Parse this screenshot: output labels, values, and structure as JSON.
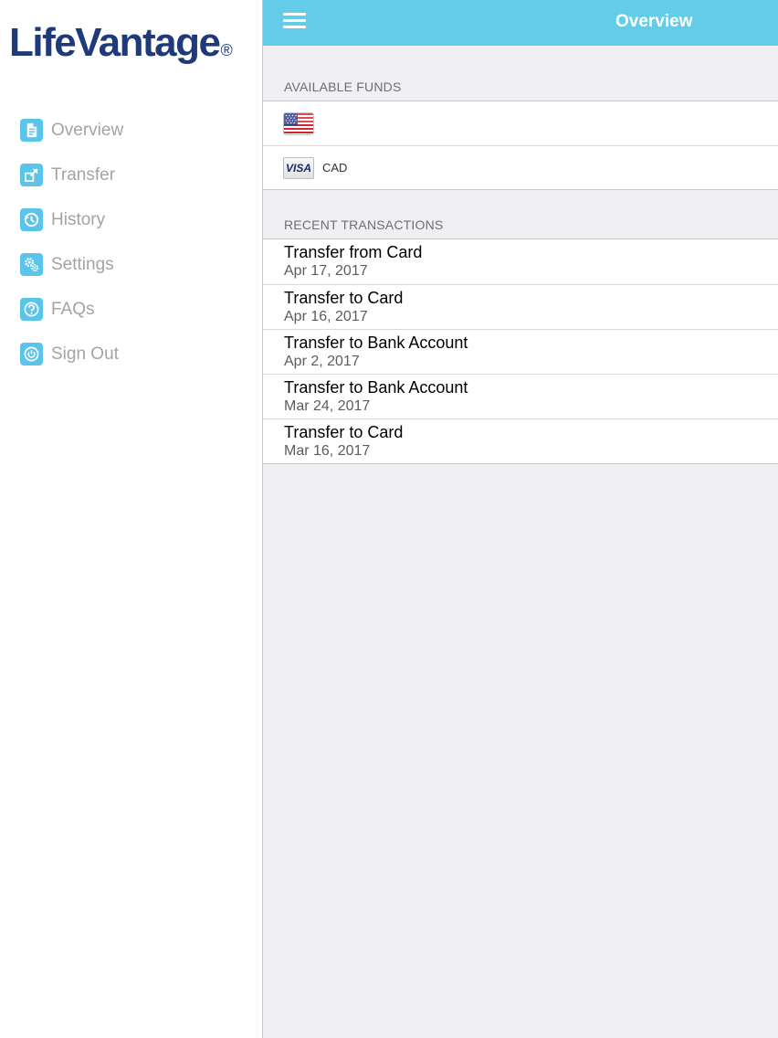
{
  "brand": {
    "name": "LifeVantage",
    "mark": "®"
  },
  "sidebar": {
    "items": [
      {
        "label": "Overview",
        "icon": "document-icon"
      },
      {
        "label": "Transfer",
        "icon": "transfer-icon"
      },
      {
        "label": "History",
        "icon": "history-icon"
      },
      {
        "label": "Settings",
        "icon": "gears-icon"
      },
      {
        "label": "FAQs",
        "icon": "question-icon"
      },
      {
        "label": "Sign Out",
        "icon": "power-icon"
      }
    ]
  },
  "header": {
    "title": "Overview",
    "menu_icon": "hamburger-icon"
  },
  "available_funds": {
    "heading": "AVAILABLE FUNDS",
    "rows": [
      {
        "icon": "us-flag-icon",
        "currency": ""
      },
      {
        "icon": "visa-card-icon",
        "card_label": "VISA",
        "currency": "CAD"
      }
    ]
  },
  "recent_transactions": {
    "heading": "RECENT TRANSACTIONS",
    "rows": [
      {
        "title": "Transfer from Card",
        "date": "Apr 17, 2017"
      },
      {
        "title": "Transfer to Card",
        "date": "Apr 16, 2017"
      },
      {
        "title": "Transfer to Bank Account",
        "date": "Apr 2, 2017"
      },
      {
        "title": "Transfer to Bank Account",
        "date": "Mar 24, 2017"
      },
      {
        "title": "Transfer to Card",
        "date": "Mar 16, 2017"
      }
    ]
  },
  "colors": {
    "accent": "#63cde9",
    "icon_bg": "#5bc4ea",
    "brand_navy": "#1f3a7a",
    "background": "#efeff4"
  }
}
